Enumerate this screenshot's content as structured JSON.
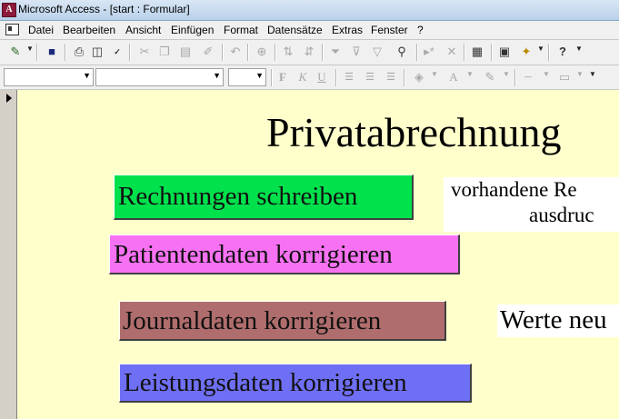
{
  "window": {
    "title": "Microsoft Access - [start : Formular]"
  },
  "menu": [
    "Datei",
    "Bearbeiten",
    "Ansicht",
    "Einfügen",
    "Format",
    "Datensätze",
    "Extras",
    "Fenster",
    "?"
  ],
  "form": {
    "heading": "Privatabrechnung",
    "buttons": {
      "rechnungen": "Rechnungen schreiben",
      "patienten": "Patientendaten korrigieren",
      "journal": "Journaldaten korrigieren",
      "leistungen": "Leistungsdaten korrigieren"
    },
    "notes": {
      "vorhandene_line1": "vorhandene Re",
      "vorhandene_line2": "ausdruc",
      "werte": "Werte neu"
    },
    "colors": {
      "background": "#ffffcc",
      "rechnungen": "#00e14c",
      "patienten": "#f772f2",
      "journal": "#b06d6d",
      "leistungen": "#6f6ff5"
    }
  },
  "toolbar": {
    "icons": [
      "design-view-icon",
      "save-icon",
      "print-icon",
      "print-preview-icon",
      "spelling-icon",
      "cut-icon",
      "copy-icon",
      "paste-icon",
      "format-painter-icon",
      "undo-icon",
      "hyperlink-icon",
      "sort-ascending-icon",
      "sort-descending-icon",
      "filter-by-selection-icon",
      "filter-by-form-icon",
      "apply-filter-icon",
      "find-icon",
      "new-record-icon",
      "delete-record-icon",
      "properties-icon",
      "database-window-icon",
      "new-object-icon",
      "help-icon"
    ],
    "format_icons": [
      "bold-icon",
      "italic-icon",
      "underline-icon",
      "align-left-icon",
      "align-center-icon",
      "align-right-icon",
      "fill-color-icon",
      "font-color-icon",
      "line-color-icon",
      "line-width-icon",
      "special-effect-icon"
    ]
  }
}
